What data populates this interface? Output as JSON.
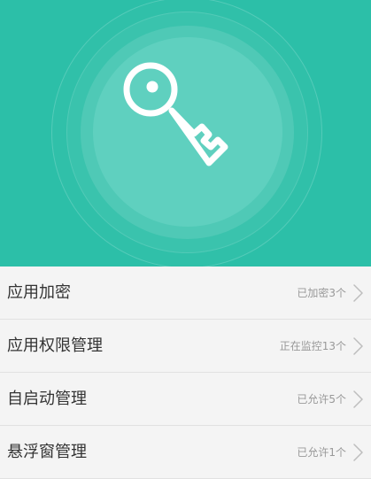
{
  "hero": {
    "icon": "key-icon",
    "background_color": "#2cbfa8"
  },
  "list": {
    "items": [
      {
        "title": "应用加密",
        "status": "已加密3个",
        "icon": "chevron-right-icon"
      },
      {
        "title": "应用权限管理",
        "status": "正在监控13个",
        "icon": "chevron-right-icon"
      },
      {
        "title": "自启动管理",
        "status": "已允许5个",
        "icon": "chevron-right-icon"
      },
      {
        "title": "悬浮窗管理",
        "status": "已允许1个",
        "icon": "chevron-right-icon"
      }
    ]
  }
}
